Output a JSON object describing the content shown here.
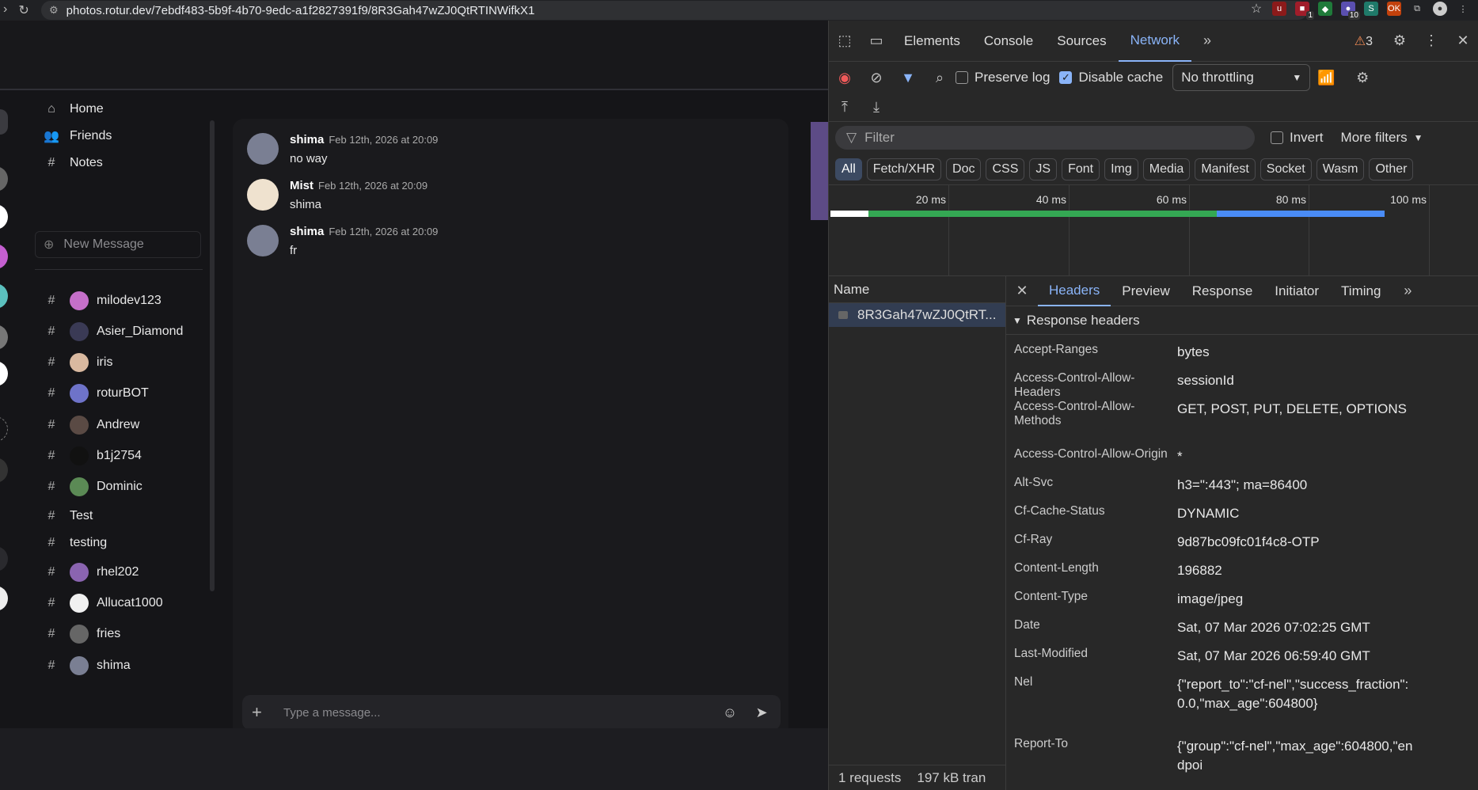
{
  "browser": {
    "url": "photos.rotur.dev/7ebdf483-5b9f-4b70-9edc-a1f2827391f9/8R3Gah47wZJ0QtRTINWifkX1",
    "ext_badges": {
      "a": "1",
      "b": "10"
    }
  },
  "sidebar": {
    "nav": [
      {
        "label": "Home",
        "icon": "home-icon"
      },
      {
        "label": "Friends",
        "icon": "users-icon"
      },
      {
        "label": "Notes",
        "icon": "hash-icon"
      }
    ],
    "new_message": "New Message",
    "dms": [
      {
        "label": "milodev123",
        "avatar_color": "#c56fc9"
      },
      {
        "label": "Asier_Diamond",
        "avatar_color": "#3a3a55"
      },
      {
        "label": "iris",
        "avatar_color": "#d9b9a0"
      },
      {
        "label": "roturBOT",
        "avatar_color": "#6e73c9"
      },
      {
        "label": "Andrew",
        "avatar_color": "#5a4a44"
      },
      {
        "label": "b1j2754",
        "avatar_color": "#111111"
      },
      {
        "label": "Dominic",
        "avatar_color": "#5b8a55"
      },
      {
        "label": "Test",
        "avatar_color": ""
      },
      {
        "label": "testing",
        "avatar_color": ""
      },
      {
        "label": "rhel202",
        "avatar_color": "#8a64b0"
      },
      {
        "label": "Allucat1000",
        "avatar_color": "#f0f0f0"
      },
      {
        "label": "fries",
        "avatar_color": "#666666"
      },
      {
        "label": "shima",
        "avatar_color": "#7a7f93"
      }
    ]
  },
  "chat": {
    "messages": [
      {
        "author": "shima",
        "time": "Feb 12th, 2026 at 20:09",
        "text": "no way"
      },
      {
        "author": "Mist",
        "time": "Feb 12th, 2026 at 20:09",
        "text": "shima"
      },
      {
        "author": "shima",
        "time": "Feb 12th, 2026 at 20:09",
        "text": "fr"
      }
    ],
    "composer_placeholder": "Type a message..."
  },
  "devtools": {
    "tabs": [
      "Elements",
      "Console",
      "Sources",
      "Network"
    ],
    "active_tab": "Network",
    "issues_count": "3",
    "preserve_log": "Preserve log",
    "disable_cache": "Disable cache",
    "throttling": "No throttling",
    "filter_placeholder": "Filter",
    "invert": "Invert",
    "more_filters": "More filters",
    "type_chips": [
      "All",
      "Fetch/XHR",
      "Doc",
      "CSS",
      "JS",
      "Font",
      "Img",
      "Media",
      "Manifest",
      "Socket",
      "Wasm",
      "Other"
    ],
    "timeline_ticks": [
      "20 ms",
      "40 ms",
      "60 ms",
      "80 ms",
      "100 ms"
    ],
    "name_header": "Name",
    "request_name": "8R3Gah47wZJ0QtRT...",
    "status_requests": "1 requests",
    "status_transferred": "197 kB tran",
    "detail_tabs": [
      "Headers",
      "Preview",
      "Response",
      "Initiator",
      "Timing"
    ],
    "section_title": "Response headers",
    "headers": [
      {
        "k": "Accept-Ranges",
        "v": "bytes"
      },
      {
        "k": "Access-Control-Allow-Headers",
        "v": "sessionId"
      },
      {
        "k": "Access-Control-Allow-Methods",
        "v": "GET, POST, PUT, DELETE, OPTIONS"
      },
      {
        "k": "Access-Control-Allow-Origin",
        "v": "*"
      },
      {
        "k": "Alt-Svc",
        "v": "h3=\":443\"; ma=86400"
      },
      {
        "k": "Cf-Cache-Status",
        "v": "DYNAMIC"
      },
      {
        "k": "Cf-Ray",
        "v": "9d87bc09fc01f4c8-OTP"
      },
      {
        "k": "Content-Length",
        "v": "196882"
      },
      {
        "k": "Content-Type",
        "v": "image/jpeg"
      },
      {
        "k": "Date",
        "v": "Sat, 07 Mar 2026 07:02:25 GMT"
      },
      {
        "k": "Last-Modified",
        "v": "Sat, 07 Mar 2026 06:59:40 GMT"
      },
      {
        "k": "Nel",
        "v": "{\"report_to\":\"cf-nel\",\"success_fraction\":0.0,\"max_age\":604800}"
      },
      {
        "k": "Report-To",
        "v": "{\"group\":\"cf-nel\",\"max_age\":604800,\"endpoi"
      }
    ]
  }
}
